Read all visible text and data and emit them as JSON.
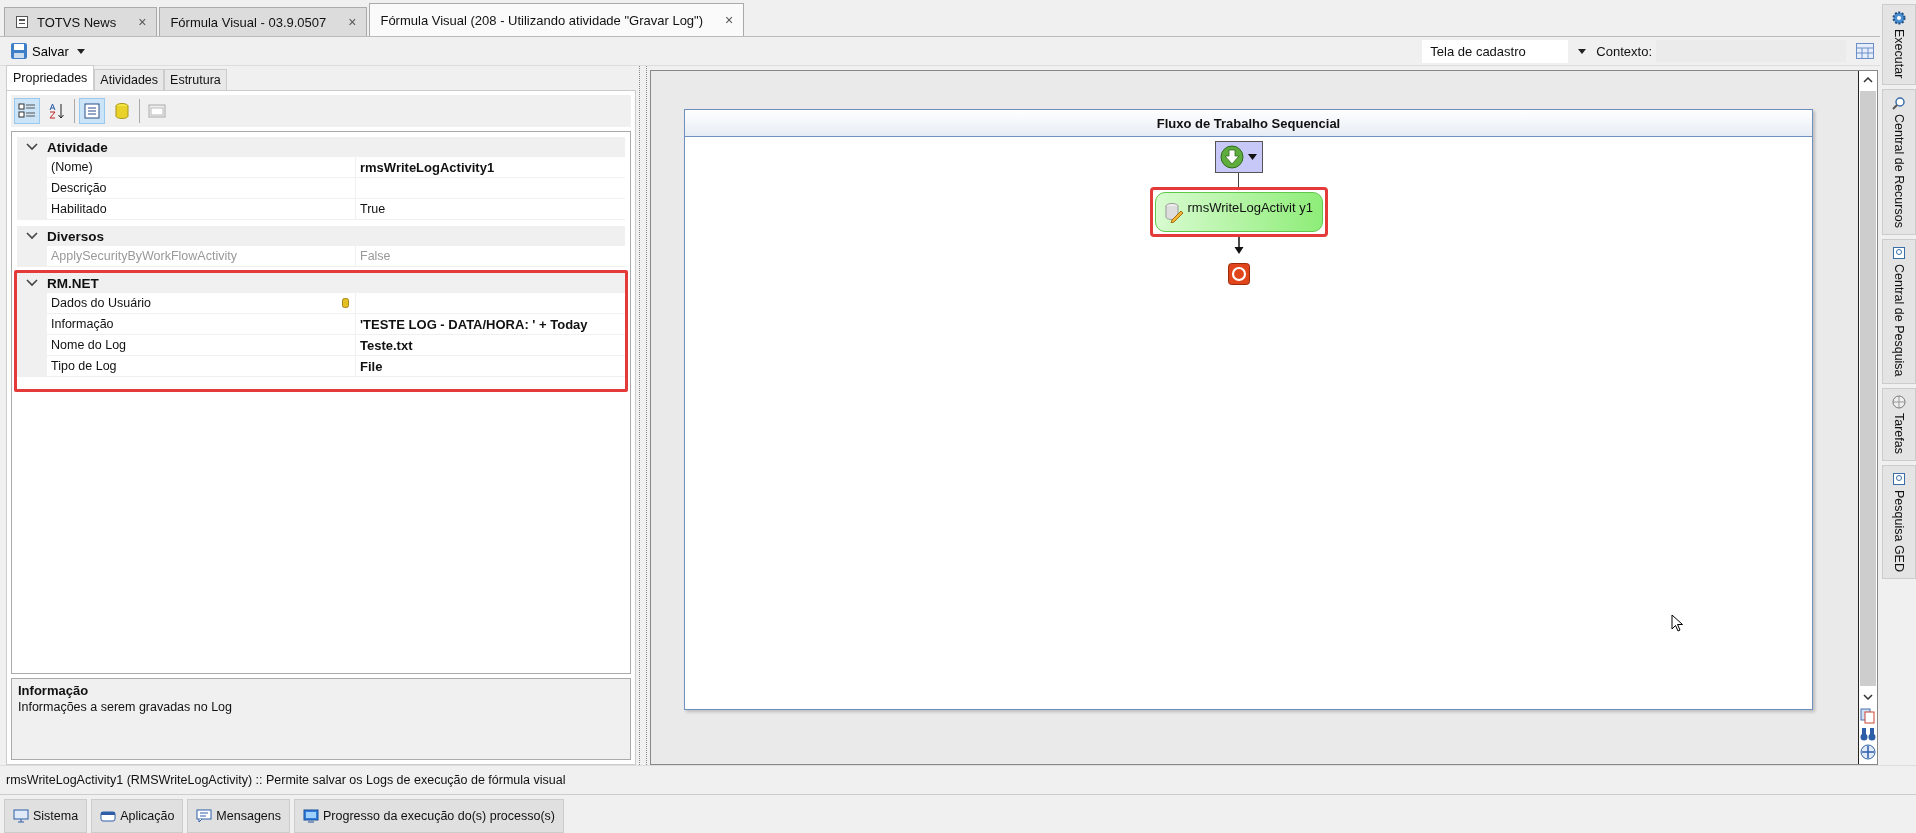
{
  "document_tabs": [
    {
      "label": "TOTVS News",
      "selected": false,
      "close": "×"
    },
    {
      "label": "Fórmula Visual - 03.9.0507",
      "selected": false,
      "close": "×"
    },
    {
      "label": "Fórmula Visual (208 - Utilizando atividade \"Gravar Log\")",
      "selected": true,
      "close": "×"
    }
  ],
  "toolbar": {
    "save_label": "Salvar",
    "screen_select": "Tela de cadastro",
    "context_label": "Contexto:"
  },
  "panel_tabs": [
    {
      "label": "Propriedades",
      "selected": true
    },
    {
      "label": "Atividades",
      "selected": false
    },
    {
      "label": "Estrutura",
      "selected": false
    }
  ],
  "grid_tools": [
    {
      "selected": true
    },
    {
      "selected": false
    },
    {
      "selected": true
    },
    {
      "selected": false
    },
    {
      "selected": false
    }
  ],
  "categories": [
    {
      "name": "Atividade",
      "expanded": true,
      "highlighted": false,
      "rows": [
        {
          "name": "(Nome)",
          "value": "rmsWriteLogActivity1",
          "modified": true,
          "disabled": false,
          "has_icon": false
        },
        {
          "name": "Descrição",
          "disabled": false,
          "has_icon": false
        },
        {
          "name": "Habilitado",
          "value": "True",
          "modified": false,
          "disabled": false,
          "has_icon": false
        }
      ]
    },
    {
      "name": "Diversos",
      "expanded": true,
      "highlighted": false,
      "rows": [
        {
          "name": "ApplySecurityByWorkFlowActivity",
          "value": "False",
          "modified": false,
          "disabled": true,
          "has_icon": false
        }
      ]
    },
    {
      "name": "RM.NET",
      "expanded": true,
      "highlighted": true,
      "rows": [
        {
          "name": "Dados do Usuário",
          "disabled": false,
          "has_icon": true
        },
        {
          "name": "Informação",
          "value": "'TESTE LOG - DATA/HORA: ' + Today",
          "modified": true,
          "disabled": false,
          "has_icon": false
        },
        {
          "name": "Nome do Log",
          "value": "Teste.txt",
          "modified": true,
          "disabled": false,
          "has_icon": false
        },
        {
          "name": "Tipo de Log",
          "value": "File",
          "modified": true,
          "disabled": false,
          "has_icon": false
        }
      ]
    }
  ],
  "description": {
    "title": "Informação",
    "text": "Informações a serem gravadas no Log"
  },
  "designer": {
    "title": "Fluxo de Trabalho Sequencial",
    "activity": {
      "label": "rmsWriteLogActivit y1",
      "highlighted": true
    }
  },
  "side_panels": [
    {
      "label": "Executar"
    },
    {
      "label": "Central de Recursos"
    },
    {
      "label": "Central de Pesquisa"
    },
    {
      "label": "Tarefas"
    },
    {
      "label": "Pesquisa GED"
    }
  ],
  "status_bar": "rmsWriteLogActivity1  (RMSWriteLogActivity)  :: Permite salvar os Logs de execução de fórmula visual",
  "bottom_tabs": [
    {
      "label": "Sistema"
    },
    {
      "label": "Aplicação"
    },
    {
      "label": "Mensagens"
    },
    {
      "label": "Progresso da execução do(s) processo(s)"
    }
  ]
}
